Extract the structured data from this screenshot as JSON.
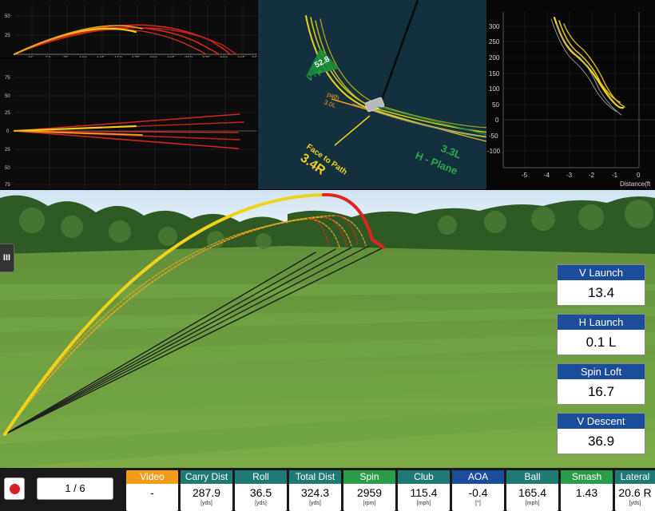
{
  "top_chart": {
    "y_ticks": [
      "50",
      "25"
    ],
    "x_ticks": [
      "25",
      "50",
      "75",
      "100",
      "125",
      "150",
      "175",
      "200",
      "225",
      "250",
      "275",
      "300",
      "325",
      "350"
    ]
  },
  "side_chart": {
    "y_ticks": [
      "75",
      "50",
      "25",
      "0",
      "25",
      "50",
      "75"
    ]
  },
  "club_panel": {
    "v_plane_value": "52.8",
    "v_plane_label": "V - P",
    "path_label": "path",
    "path_value": "3.0L",
    "face_to_path_label": "Face to Path",
    "face_to_path_value": "3.4R",
    "h_plane_value": "3.3L",
    "h_plane_label": "H - Plane"
  },
  "spin_chart": {
    "y_ticks": [
      "300",
      "250",
      "200",
      "150",
      "100",
      "50",
      "0",
      "-50",
      "-100"
    ],
    "x_ticks": [
      "-5",
      "-4",
      "-3",
      "-2",
      "-1",
      "0"
    ],
    "x_label": "Distance(ft"
  },
  "side_tab_label": "III",
  "launch_stats": [
    {
      "label": "V Launch",
      "value": "13.4"
    },
    {
      "label": "H Launch",
      "value": "0.1 L"
    },
    {
      "label": "Spin Loft",
      "value": "16.7"
    },
    {
      "label": "V Descent",
      "value": "36.9"
    }
  ],
  "page_indicator": "1 / 6",
  "metrics": [
    {
      "label": "Video",
      "value": "-",
      "unit": "",
      "color": "#f39b1b"
    },
    {
      "label": "Carry Dist",
      "value": "287.9",
      "unit": "[yds]",
      "color": "#1f7a73"
    },
    {
      "label": "Roll",
      "value": "36.5",
      "unit": "[yds]",
      "color": "#1f7a73"
    },
    {
      "label": "Total Dist",
      "value": "324.3",
      "unit": "[yds]",
      "color": "#1f7a73"
    },
    {
      "label": "Spin",
      "value": "2959",
      "unit": "[rpm]",
      "color": "#2a9d48"
    },
    {
      "label": "Club",
      "value": "115.4",
      "unit": "[mph]",
      "color": "#1f7a73"
    },
    {
      "label": "AOA",
      "value": "-0.4",
      "unit": "[°]",
      "color": "#1b4d9b"
    },
    {
      "label": "Ball",
      "value": "165.4",
      "unit": "[mph]",
      "color": "#1f7a73"
    },
    {
      "label": "Smash",
      "value": "1.43",
      "unit": "",
      "color": "#2a9d48"
    },
    {
      "label": "Lateral",
      "value": "20.6 R",
      "unit": "[yds]",
      "color": "#1f7a73"
    }
  ]
}
